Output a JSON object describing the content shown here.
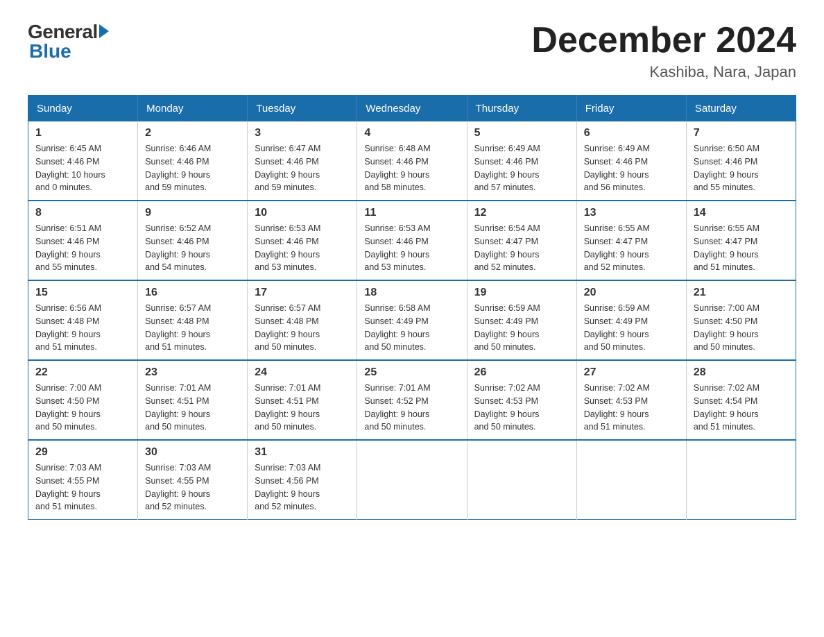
{
  "logo": {
    "general": "General",
    "blue": "Blue"
  },
  "title": "December 2024",
  "subtitle": "Kashiba, Nara, Japan",
  "days_of_week": [
    "Sunday",
    "Monday",
    "Tuesday",
    "Wednesday",
    "Thursday",
    "Friday",
    "Saturday"
  ],
  "weeks": [
    [
      {
        "day": "1",
        "sunrise": "6:45 AM",
        "sunset": "4:46 PM",
        "daylight": "10 hours and 0 minutes."
      },
      {
        "day": "2",
        "sunrise": "6:46 AM",
        "sunset": "4:46 PM",
        "daylight": "9 hours and 59 minutes."
      },
      {
        "day": "3",
        "sunrise": "6:47 AM",
        "sunset": "4:46 PM",
        "daylight": "9 hours and 59 minutes."
      },
      {
        "day": "4",
        "sunrise": "6:48 AM",
        "sunset": "4:46 PM",
        "daylight": "9 hours and 58 minutes."
      },
      {
        "day": "5",
        "sunrise": "6:49 AM",
        "sunset": "4:46 PM",
        "daylight": "9 hours and 57 minutes."
      },
      {
        "day": "6",
        "sunrise": "6:49 AM",
        "sunset": "4:46 PM",
        "daylight": "9 hours and 56 minutes."
      },
      {
        "day": "7",
        "sunrise": "6:50 AM",
        "sunset": "4:46 PM",
        "daylight": "9 hours and 55 minutes."
      }
    ],
    [
      {
        "day": "8",
        "sunrise": "6:51 AM",
        "sunset": "4:46 PM",
        "daylight": "9 hours and 55 minutes."
      },
      {
        "day": "9",
        "sunrise": "6:52 AM",
        "sunset": "4:46 PM",
        "daylight": "9 hours and 54 minutes."
      },
      {
        "day": "10",
        "sunrise": "6:53 AM",
        "sunset": "4:46 PM",
        "daylight": "9 hours and 53 minutes."
      },
      {
        "day": "11",
        "sunrise": "6:53 AM",
        "sunset": "4:46 PM",
        "daylight": "9 hours and 53 minutes."
      },
      {
        "day": "12",
        "sunrise": "6:54 AM",
        "sunset": "4:47 PM",
        "daylight": "9 hours and 52 minutes."
      },
      {
        "day": "13",
        "sunrise": "6:55 AM",
        "sunset": "4:47 PM",
        "daylight": "9 hours and 52 minutes."
      },
      {
        "day": "14",
        "sunrise": "6:55 AM",
        "sunset": "4:47 PM",
        "daylight": "9 hours and 51 minutes."
      }
    ],
    [
      {
        "day": "15",
        "sunrise": "6:56 AM",
        "sunset": "4:48 PM",
        "daylight": "9 hours and 51 minutes."
      },
      {
        "day": "16",
        "sunrise": "6:57 AM",
        "sunset": "4:48 PM",
        "daylight": "9 hours and 51 minutes."
      },
      {
        "day": "17",
        "sunrise": "6:57 AM",
        "sunset": "4:48 PM",
        "daylight": "9 hours and 50 minutes."
      },
      {
        "day": "18",
        "sunrise": "6:58 AM",
        "sunset": "4:49 PM",
        "daylight": "9 hours and 50 minutes."
      },
      {
        "day": "19",
        "sunrise": "6:59 AM",
        "sunset": "4:49 PM",
        "daylight": "9 hours and 50 minutes."
      },
      {
        "day": "20",
        "sunrise": "6:59 AM",
        "sunset": "4:49 PM",
        "daylight": "9 hours and 50 minutes."
      },
      {
        "day": "21",
        "sunrise": "7:00 AM",
        "sunset": "4:50 PM",
        "daylight": "9 hours and 50 minutes."
      }
    ],
    [
      {
        "day": "22",
        "sunrise": "7:00 AM",
        "sunset": "4:50 PM",
        "daylight": "9 hours and 50 minutes."
      },
      {
        "day": "23",
        "sunrise": "7:01 AM",
        "sunset": "4:51 PM",
        "daylight": "9 hours and 50 minutes."
      },
      {
        "day": "24",
        "sunrise": "7:01 AM",
        "sunset": "4:51 PM",
        "daylight": "9 hours and 50 minutes."
      },
      {
        "day": "25",
        "sunrise": "7:01 AM",
        "sunset": "4:52 PM",
        "daylight": "9 hours and 50 minutes."
      },
      {
        "day": "26",
        "sunrise": "7:02 AM",
        "sunset": "4:53 PM",
        "daylight": "9 hours and 50 minutes."
      },
      {
        "day": "27",
        "sunrise": "7:02 AM",
        "sunset": "4:53 PM",
        "daylight": "9 hours and 51 minutes."
      },
      {
        "day": "28",
        "sunrise": "7:02 AM",
        "sunset": "4:54 PM",
        "daylight": "9 hours and 51 minutes."
      }
    ],
    [
      {
        "day": "29",
        "sunrise": "7:03 AM",
        "sunset": "4:55 PM",
        "daylight": "9 hours and 51 minutes."
      },
      {
        "day": "30",
        "sunrise": "7:03 AM",
        "sunset": "4:55 PM",
        "daylight": "9 hours and 52 minutes."
      },
      {
        "day": "31",
        "sunrise": "7:03 AM",
        "sunset": "4:56 PM",
        "daylight": "9 hours and 52 minutes."
      },
      null,
      null,
      null,
      null
    ]
  ],
  "labels": {
    "sunrise": "Sunrise:",
    "sunset": "Sunset:",
    "daylight": "Daylight:"
  }
}
